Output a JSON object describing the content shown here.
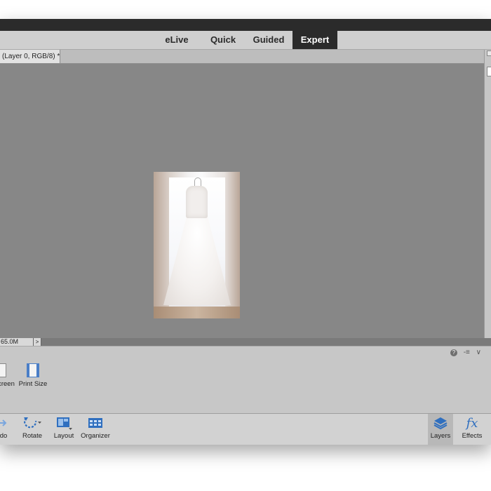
{
  "modes": {
    "elive": "eLive",
    "quick": "Quick",
    "guided": "Guided",
    "expert": "Expert",
    "active": "Expert"
  },
  "document": {
    "tab_label": "(Layer 0, RGB/8) *"
  },
  "status": {
    "doc_size": "65.0M",
    "arrow": ">"
  },
  "bin": {
    "controls": {
      "help": "?",
      "menu": "-≡",
      "collapse": "∨"
    },
    "items": [
      {
        "label": "creen",
        "icon": "screen-fit-icon"
      },
      {
        "label": "Print Size",
        "icon": "print-size-icon"
      }
    ]
  },
  "taskbar": {
    "undo": "do",
    "rotate": "Rotate",
    "layout": "Layout",
    "organizer": "Organizer",
    "layers": "Layers",
    "effects": "Effects",
    "effects_glyph": "fx"
  },
  "colors": {
    "canvas": "#878787",
    "active_tab": "#2b2b2b",
    "accent": "#2f6fbf"
  }
}
